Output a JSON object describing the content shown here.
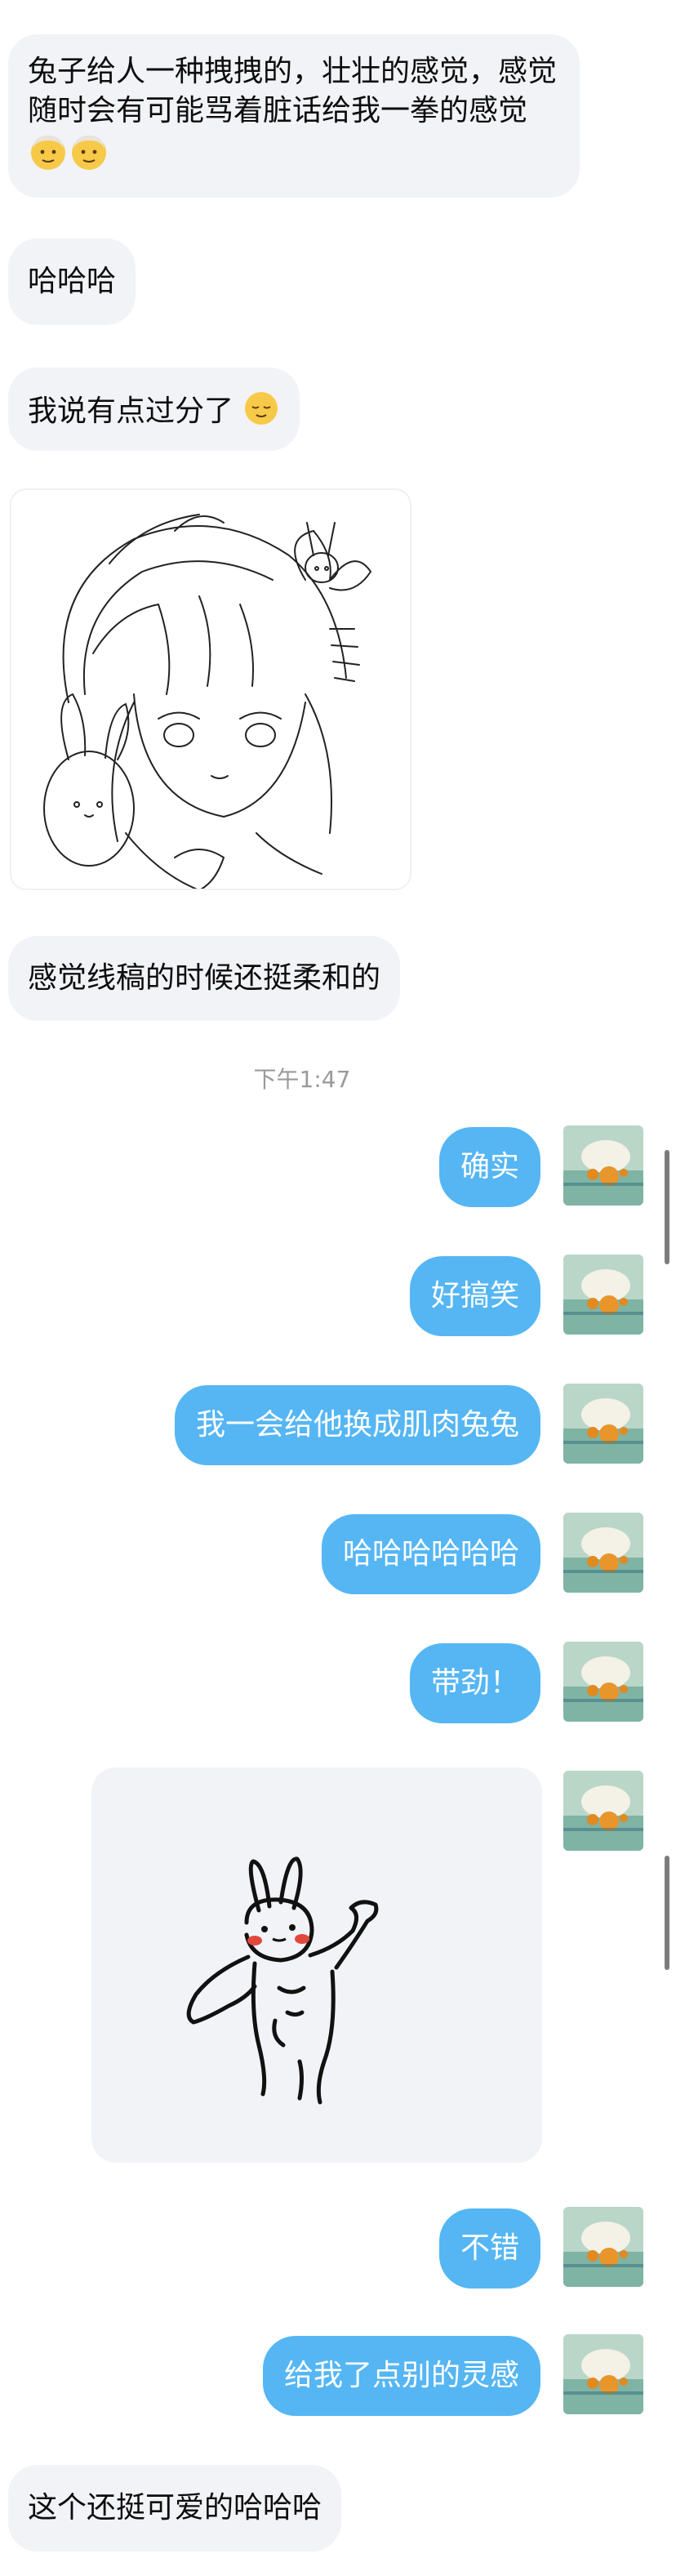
{
  "incoming": {
    "msg1": "兔子给人一种拽拽的，壮壮的感觉，感觉随时会有可能骂着脏话给我一拳的感觉",
    "msg2": "哈哈哈",
    "msg3": "我说有点过分了",
    "msg4": "感觉线稿的时候还挺柔和的",
    "msg5": "这个还挺可爱的哈哈哈"
  },
  "timestamp": "下午1:47",
  "outgoing": {
    "msg1": "确实",
    "msg2": "好搞笑",
    "msg3": "我一会给他换成肌肉兔兔",
    "msg4": "哈哈哈哈哈哈",
    "msg5": "带劲！",
    "msg6": "不错",
    "msg7": "给我了点别的灵感"
  },
  "icons": {
    "avatar": "avatar-icon",
    "emoji_old_face": "older-person-emoji",
    "emoji_relieved": "relieved-face-emoji"
  },
  "colors": {
    "incoming_bubble": "#f2f3f6",
    "outgoing_bubble": "#55b6f3"
  }
}
